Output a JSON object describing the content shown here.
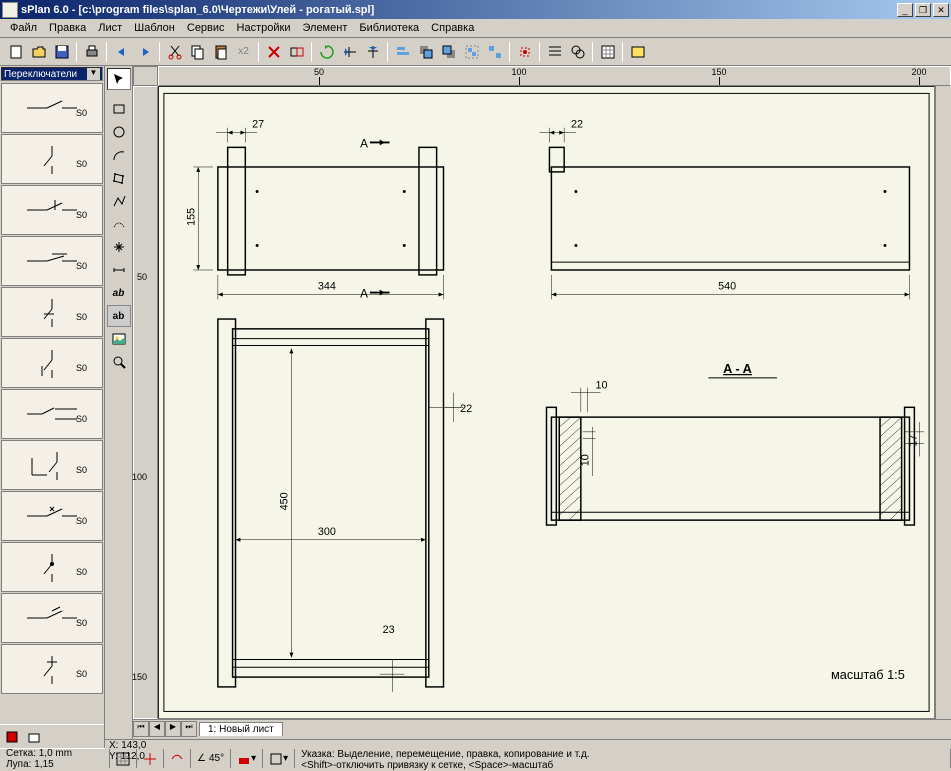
{
  "title": "sPlan 6.0 - [c:\\program files\\splan_6.0\\Чертежи\\Улей - рогатый.spl]",
  "menu": [
    "Файл",
    "Правка",
    "Лист",
    "Шаблон",
    "Сервис",
    "Настройки",
    "Элемент",
    "Библиотека",
    "Справка"
  ],
  "library": {
    "selected": "Переключатели",
    "items": [
      {
        "label": "S0"
      },
      {
        "label": "S0"
      },
      {
        "label": "S0"
      },
      {
        "label": "S0"
      },
      {
        "label": "S0"
      },
      {
        "label": "S0"
      },
      {
        "label": "S0"
      },
      {
        "label": "S0"
      },
      {
        "label": "S0"
      },
      {
        "label": "S0"
      },
      {
        "label": "S0"
      },
      {
        "label": "S0"
      }
    ]
  },
  "ruler_h": [
    50,
    100,
    150,
    200
  ],
  "ruler_v": [
    50,
    100,
    150
  ],
  "drawing": {
    "dims": {
      "d27": "27",
      "d155": "155",
      "d344": "344",
      "d22a": "22",
      "d540": "540",
      "d450": "450",
      "d300": "300",
      "d22b": "22",
      "d23": "23",
      "d10a": "10",
      "d10b": "10",
      "d17": "17"
    },
    "labels": {
      "sectionA1": "A",
      "sectionA2": "A",
      "sectionAA": "A - A",
      "scale": "масштаб  1:5"
    }
  },
  "tabs": {
    "active": "1: Новый лист"
  },
  "status": {
    "coords_x": "X: 143,0",
    "coords_y": "Y: 112,0",
    "grid": "Сетка: 1,0 mm",
    "zoom": "Лупа: 1,15",
    "angle": "45°",
    "hint": "Указка: Выделение, перемещение, правка, копирование и т.д.",
    "hint2": "<Shift>-отключить привязку к сетке, <Space>-масштаб"
  },
  "toolbar_paste_count": "x2"
}
